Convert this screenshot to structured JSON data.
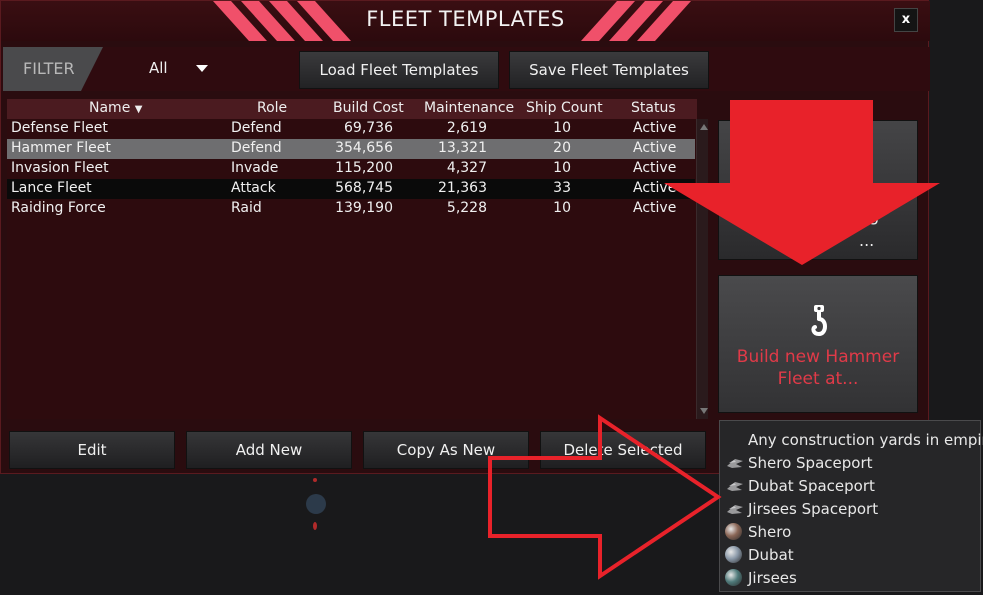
{
  "window": {
    "title": "FLEET TEMPLATES",
    "close_label": "x"
  },
  "filter": {
    "label": "FILTER",
    "selected": "All"
  },
  "toolbar": {
    "load_label": "Load Fleet Templates",
    "save_label": "Save Fleet Templates"
  },
  "table": {
    "columns": [
      "Name",
      "Role",
      "Build Cost",
      "Maintenance",
      "Ship Count",
      "Status"
    ],
    "rows": [
      {
        "name": "Defense Fleet",
        "role": "Defend",
        "build_cost": "69,736",
        "maintenance": "2,619",
        "ship_count": "10",
        "status": "Active"
      },
      {
        "name": "Hammer Fleet",
        "role": "Defend",
        "build_cost": "354,656",
        "maintenance": "13,321",
        "ship_count": "20",
        "status": "Active"
      },
      {
        "name": "Invasion Fleet",
        "role": "Invade",
        "build_cost": "115,200",
        "maintenance": "4,327",
        "ship_count": "10",
        "status": "Active"
      },
      {
        "name": "Lance Fleet",
        "role": "Attack",
        "build_cost": "568,745",
        "maintenance": "21,363",
        "ship_count": "33",
        "status": "Active"
      },
      {
        "name": "Raiding Force",
        "role": "Raid",
        "build_cost": "139,190",
        "maintenance": "5,228",
        "ship_count": "10",
        "status": "Active"
      }
    ],
    "selected_row": 1
  },
  "actions": {
    "edit_label": "Edit",
    "add_new_label": "Add New",
    "copy_as_new_label": "Copy As New",
    "delete_selected_label": "Delete Selected"
  },
  "side": {
    "top_card_line1": "g",
    "top_card_line2": "...",
    "build_line1": "Build new Hammer",
    "build_line2": "Fleet at..."
  },
  "dropdown": {
    "items": [
      {
        "label": "Any construction yards in empire",
        "icon": "none"
      },
      {
        "label": "Shero Spaceport",
        "icon": "spaceport-icon"
      },
      {
        "label": "Dubat Spaceport",
        "icon": "spaceport-icon"
      },
      {
        "label": "Jirsees Spaceport",
        "icon": "spaceport-icon"
      },
      {
        "label": "Shero",
        "icon": "planet-icon"
      },
      {
        "label": "Dubat",
        "icon": "planet-icon"
      },
      {
        "label": "Jirsees",
        "icon": "planet-icon"
      }
    ]
  },
  "colors": {
    "accent": "#f0506a",
    "highlight_arrow": "#e8222a",
    "build_text": "#e03a48"
  }
}
